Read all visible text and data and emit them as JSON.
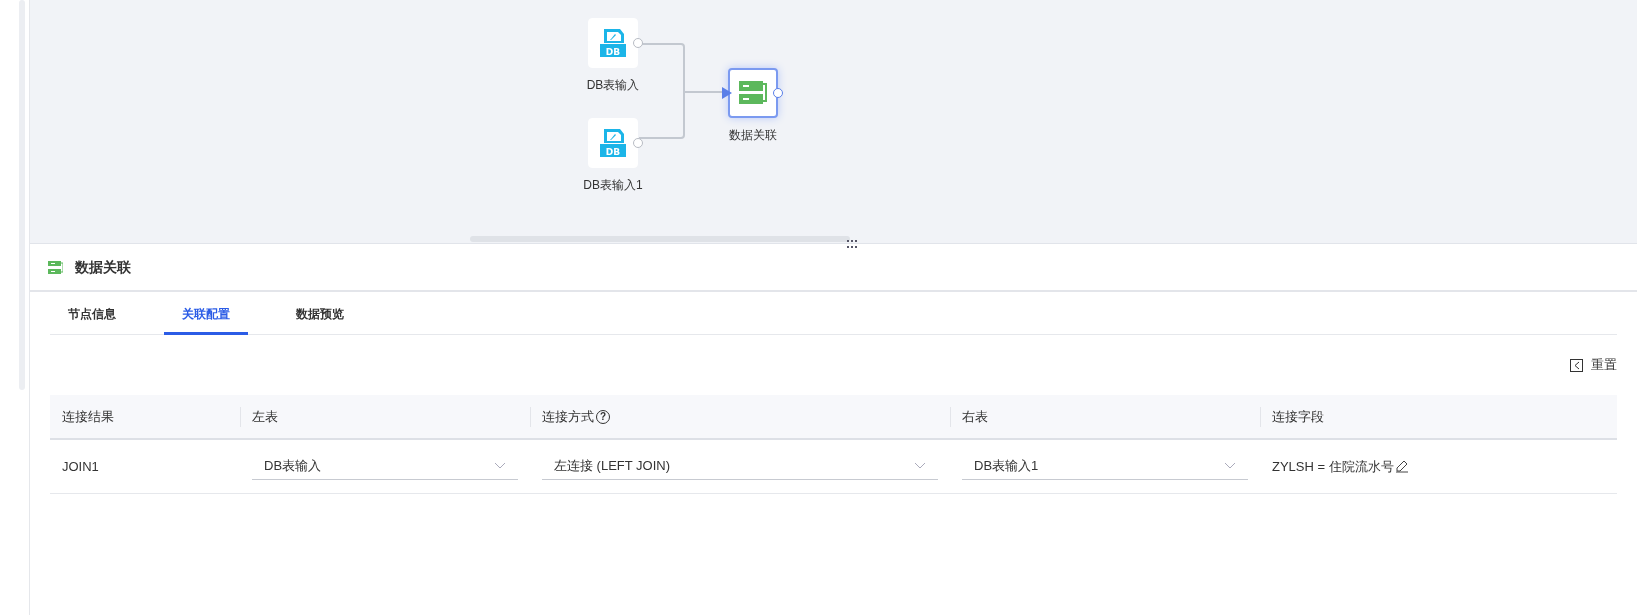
{
  "canvas": {
    "nodes": [
      {
        "kind": "db_input",
        "icon_text": "DB",
        "label": "DB表输入",
        "selected": false
      },
      {
        "kind": "db_input",
        "icon_text": "DB",
        "label": "DB表输入1",
        "selected": false
      },
      {
        "kind": "join",
        "label": "数据关联",
        "selected": true
      }
    ]
  },
  "panel": {
    "title": "数据关联",
    "tabs": [
      {
        "label": "节点信息",
        "selected": false
      },
      {
        "label": "关联配置",
        "selected": true
      },
      {
        "label": "数据预览",
        "selected": false
      }
    ],
    "reset_button": "重置",
    "table": {
      "columns": [
        {
          "label": "连接结果"
        },
        {
          "label": "左表"
        },
        {
          "label": "连接方式",
          "help_mark": "?"
        },
        {
          "label": "右表"
        },
        {
          "label": "连接字段"
        }
      ],
      "rows": [
        {
          "result": "JOIN1",
          "left_table": "DB表输入",
          "join_type": "左连接 (LEFT JOIN)",
          "right_table": "DB表输入1",
          "join_field": "ZYLSH = 住院流水号"
        }
      ]
    }
  }
}
